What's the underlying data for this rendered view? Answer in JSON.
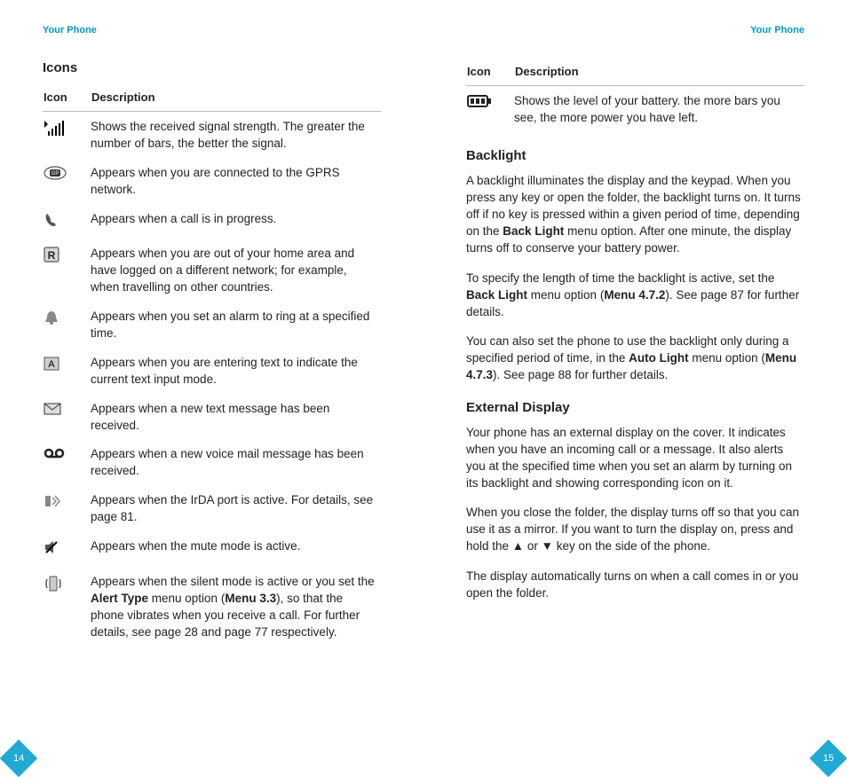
{
  "left": {
    "header": "Your Phone",
    "title": "Icons",
    "table": {
      "col_icon": "Icon",
      "col_desc": "Description",
      "rows": [
        {
          "icon": "signal-strength-icon",
          "html": "Shows the received signal strength. The greater the number of bars, the better the signal."
        },
        {
          "icon": "gprs-icon",
          "html": "Appears when you are connected to the GPRS network."
        },
        {
          "icon": "call-icon",
          "html": "Appears when a call is in progress."
        },
        {
          "icon": "roaming-icon",
          "html": "Appears when you are out of your home area and have logged on a different network; for example, when travelling on other countries."
        },
        {
          "icon": "alarm-icon",
          "html": "Appears when you set an alarm to ring at a specified time."
        },
        {
          "icon": "text-input-icon",
          "html": "Appears when you are entering text to indicate the current text input mode."
        },
        {
          "icon": "sms-icon",
          "html": "Appears when a new text message has been received."
        },
        {
          "icon": "voicemail-icon",
          "html": "Appears when a new voice mail message has been received."
        },
        {
          "icon": "irda-icon",
          "html": "Appears when the IrDA port is active. For details, see page 81."
        },
        {
          "icon": "mute-icon",
          "html": "Appears when the mute mode is active."
        },
        {
          "icon": "silent-vibrate-icon",
          "html": "Appears when the silent mode is active or you set the <b>Alert Type</b> menu option (<b>Menu 3.3</b>), so that the phone vibrates when you receive a call. For further details, see page 28 and page 77 respectively."
        }
      ]
    },
    "page_number": "14"
  },
  "right": {
    "header": "Your Phone",
    "table": {
      "col_icon": "Icon",
      "col_desc": "Description",
      "rows": [
        {
          "icon": "battery-icon",
          "html": "Shows the level of your battery. the more bars you see, the more power you have left."
        }
      ]
    },
    "sections": [
      {
        "heading": "Backlight",
        "paragraphs": [
          "A backlight illuminates the display and the keypad. When you press any key or open the folder, the backlight turns on. It turns off if no key is pressed within a given period of time, depending on the <b>Back Light</b> menu option. After one minute, the display turns off to conserve your battery power.",
          "To specify the length of time the backlight is active, set the <b>Back Light</b> menu option (<b>Menu 4.7.2</b>). See page 87 for further details.",
          "You can also set the phone to use the backlight only during a specified period of time, in the <b>Auto Light</b> menu option (<b>Menu 4.7.3</b>). See page 88 for further details."
        ]
      },
      {
        "heading": "External Display",
        "paragraphs": [
          "Your phone has an external display on the cover. It indicates when you have an incoming call or a message. It also alerts you at the specified time when you set an alarm by turning on its backlight and showing corresponding icon on it.",
          "When you close the folder, the display turns off so that you can use it as a mirror. If you want to turn the display on, press and hold the ▲ or ▼ key on the side of the phone.",
          "The display automatically turns on when a call comes in or you open the folder."
        ]
      }
    ],
    "page_number": "15"
  }
}
